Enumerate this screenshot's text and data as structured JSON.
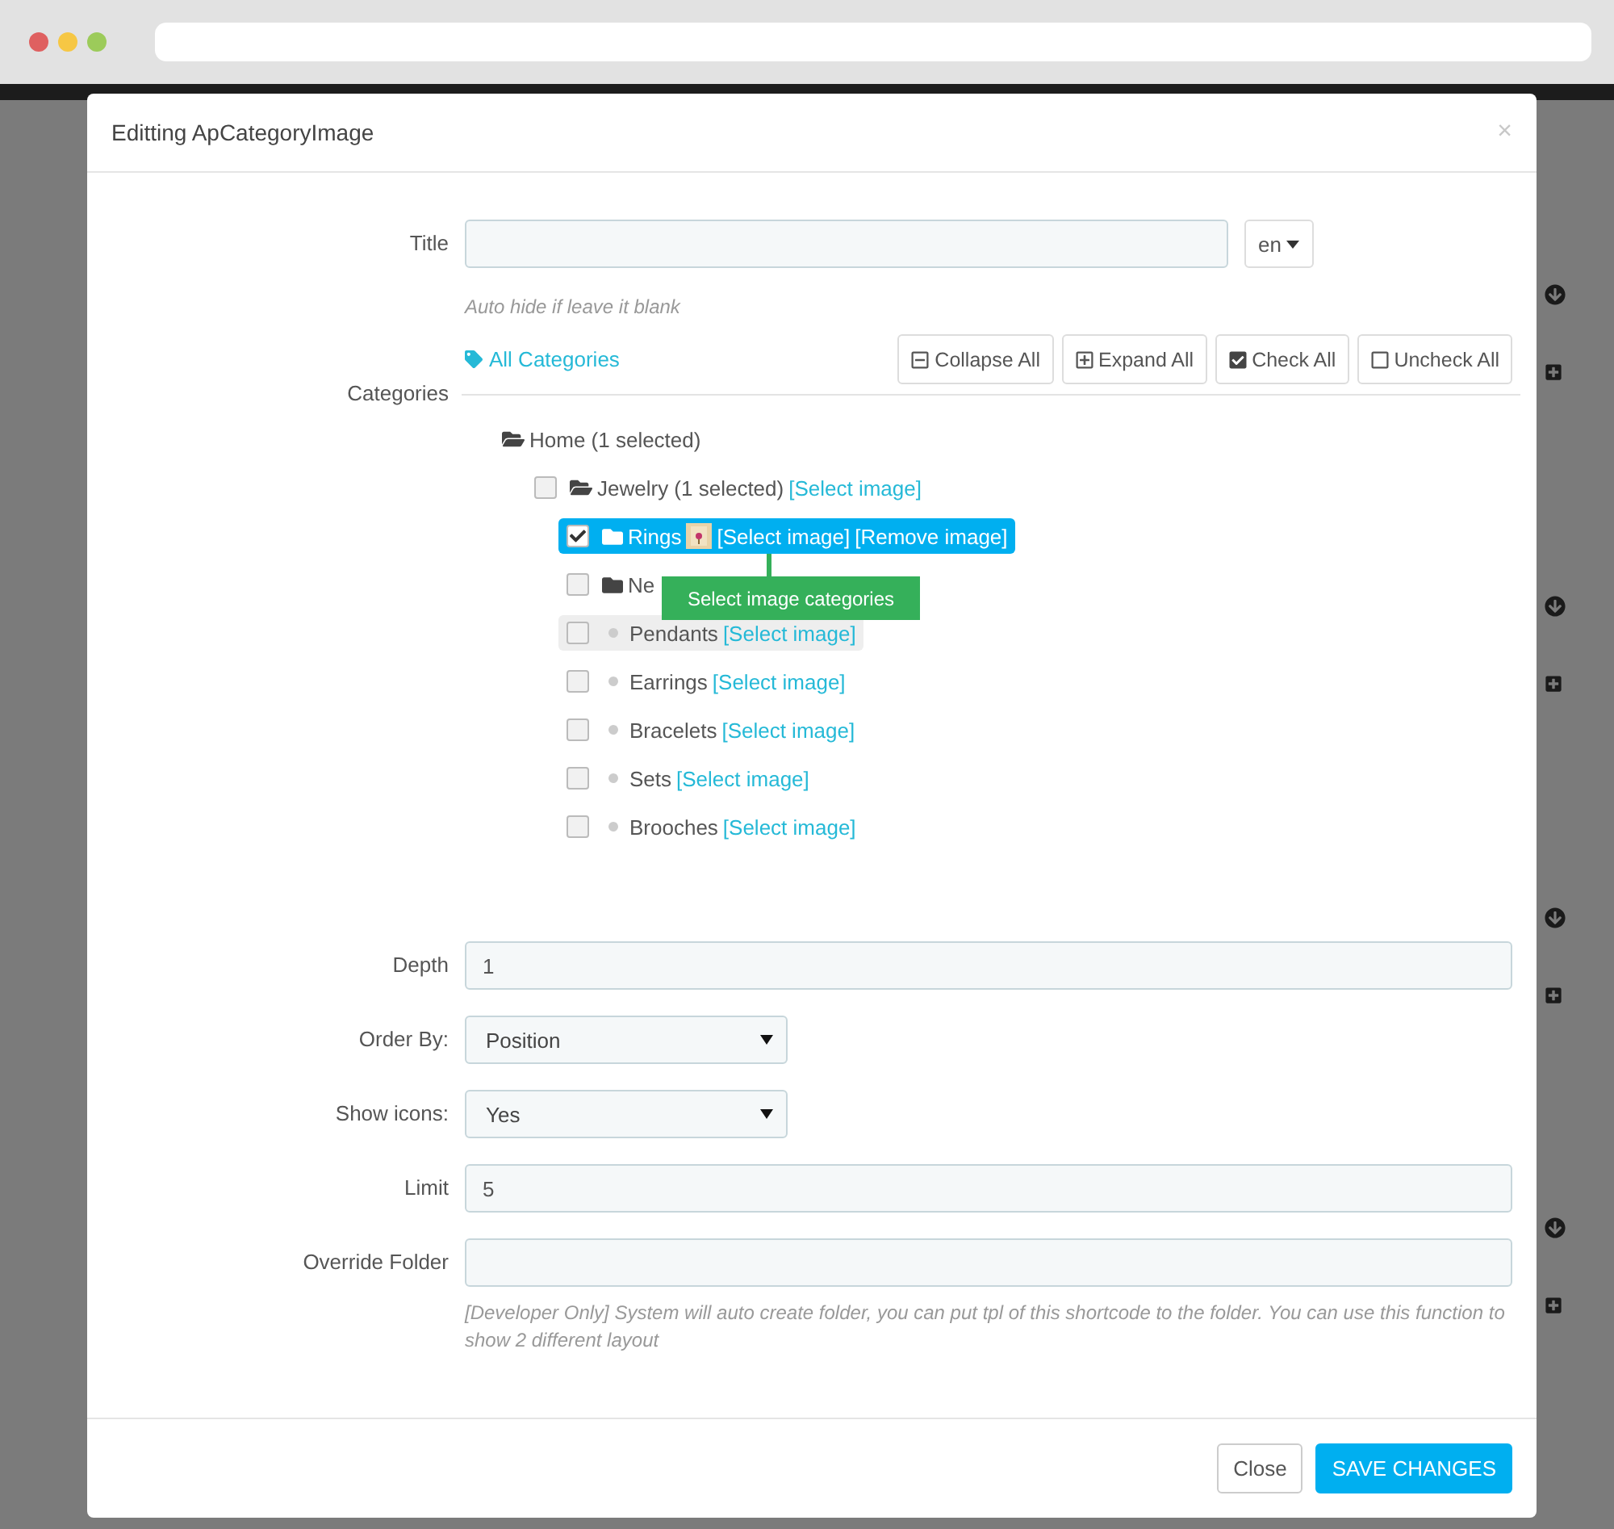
{
  "window": {
    "title": "Editting ApCategoryImage",
    "close": "×"
  },
  "title_field": {
    "label": "Title",
    "language": "en",
    "hint": "Auto hide if leave it blank"
  },
  "categories": {
    "label": "Categories",
    "link": "All Categories",
    "buttons": [
      {
        "label": "Collapse All",
        "kind": "collapse"
      },
      {
        "label": "Expand All",
        "kind": "expand"
      },
      {
        "label": "Check All",
        "kind": "check"
      },
      {
        "label": "Uncheck All",
        "kind": "uncheck"
      }
    ],
    "tree": [
      {
        "kind": "root",
        "label": "Home (1 selected)",
        "expanded": true,
        "children": [
          {
            "kind": "folder",
            "label": "Jewelry (1 selected)",
            "links": [
              "[Select image]"
            ],
            "checked": false,
            "selected": false,
            "expanded": true,
            "children": [
              {
                "kind": "folder",
                "label": "Rings",
                "thumbnail": true,
                "links": [
                  "[Select image]",
                  "[Remove image]"
                ],
                "checked": true,
                "selected": true,
                "expanded": false
              },
              {
                "kind": "folder",
                "label": "Ne",
                "checked": false,
                "selected": false,
                "expanded": false
              },
              {
                "kind": "leaf",
                "label": "Pendants",
                "links": [
                  "[Select image]"
                ],
                "checked": false,
                "selected": false,
                "hovered": true
              },
              {
                "kind": "leaf",
                "label": "Earrings",
                "links": [
                  "[Select image]"
                ],
                "checked": false,
                "selected": false,
                "hovered": false
              },
              {
                "kind": "leaf",
                "label": "Bracelets",
                "links": [
                  "[Select image]"
                ],
                "checked": false,
                "selected": false,
                "hovered": false
              },
              {
                "kind": "leaf",
                "label": "Sets",
                "links": [
                  "[Select image]"
                ],
                "checked": false,
                "selected": false,
                "hovered": false
              },
              {
                "kind": "leaf",
                "label": "Brooches",
                "links": [
                  "[Select image]"
                ],
                "checked": false,
                "selected": false,
                "hovered": false
              }
            ]
          }
        ]
      }
    ],
    "tooltip": "Select image categories"
  },
  "fields": [
    {
      "label": "Depth",
      "kind": "input",
      "value": "1"
    },
    {
      "label": "Order By:",
      "kind": "select",
      "value": "Position"
    },
    {
      "label": "Show icons:",
      "kind": "select",
      "value": "Yes"
    },
    {
      "label": "Limit",
      "kind": "input",
      "value": "5"
    },
    {
      "label": "Override Folder",
      "kind": "input",
      "hint": "[Developer Only] System will auto create folder, you can put tpl of this shortcode to the folder. You can use this function to show 2 different layout"
    }
  ],
  "footer": [
    {
      "label": "Close",
      "kind": "default"
    },
    {
      "label": "SAVE CHANGES",
      "kind": "primary"
    }
  ]
}
